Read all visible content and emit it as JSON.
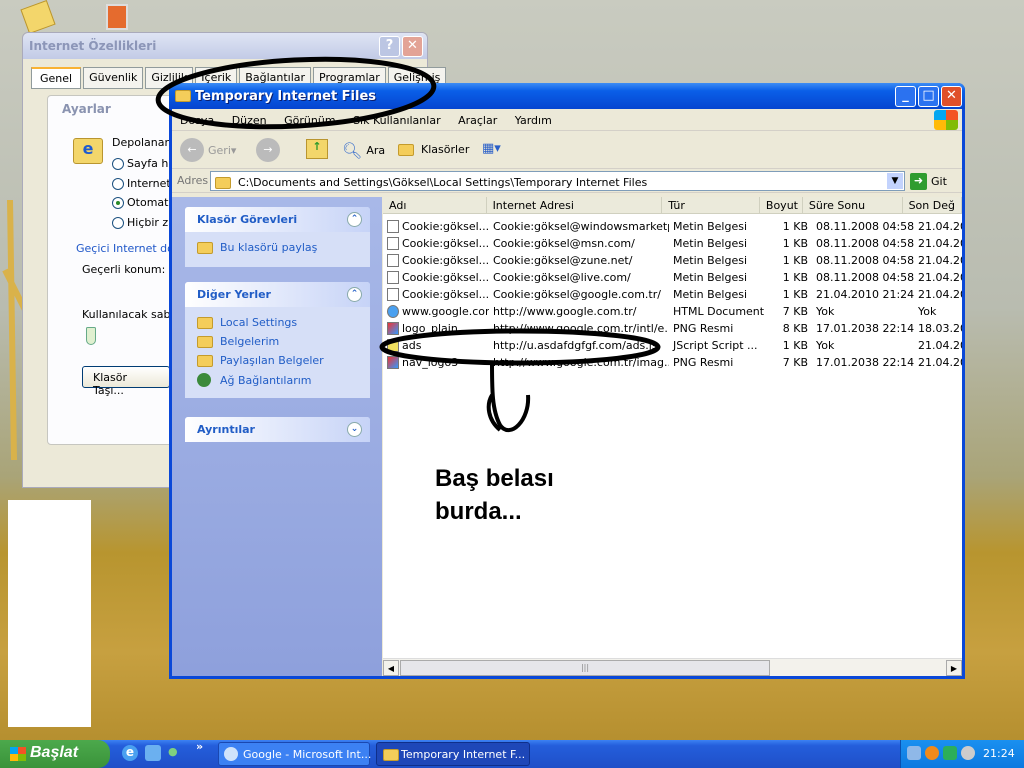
{
  "desktop": {
    "icons": [
      "folder-icon",
      "app-icon"
    ]
  },
  "internet_options": {
    "title": "Internet Özellikleri",
    "tabs": [
      "Genel",
      "Güvenlik",
      "Gizlilik",
      "İçerik",
      "Bağlantılar",
      "Programlar",
      "Gelişmiş"
    ],
    "group_title": "Ayarlar",
    "depolanan_label": "Depolanan s",
    "radios": [
      {
        "label": "Sayfa he",
        "checked": false
      },
      {
        "label": "Internet",
        "checked": false
      },
      {
        "label": "Otomatik",
        "checked": true
      },
      {
        "label": "Hiçbir zar",
        "checked": false
      }
    ],
    "link": "Geçici Internet dos",
    "current_location_label": "Geçerli konum:",
    "disk_label": "Kullanılacak sabit d",
    "move_folder_button": "Klasör Taşı..."
  },
  "explorer": {
    "title": "Temporary Internet Files",
    "menu": [
      "Dosya",
      "Düzen",
      "Görünüm",
      "Sık Kullanılanlar",
      "Araçlar",
      "Yardım"
    ],
    "toolbar": {
      "back": "Geri",
      "search": "Ara",
      "folders": "Klasörler"
    },
    "address_label": "Adres",
    "address": "C:\\Documents and Settings\\Göksel\\Local Settings\\Temporary Internet Files",
    "go": "Git",
    "tasks": {
      "title": "Klasör Görevleri",
      "items": [
        "Bu klasörü paylaş"
      ]
    },
    "other_places": {
      "title": "Diğer Yerler",
      "items": [
        "Local Settings",
        "Belgelerim",
        "Paylaşılan Belgeler",
        "Ağ Bağlantılarım"
      ]
    },
    "details": {
      "title": "Ayrıntılar"
    },
    "columns": [
      "Adı",
      "Internet Adresi",
      "Tür",
      "Boyut",
      "Süre Sonu",
      "Son Değ"
    ],
    "rows": [
      [
        "Cookie:göksel...",
        "Cookie:göksel@windowsmarketp...",
        "Metin Belgesi",
        "1 KB",
        "08.11.2008 04:58",
        "21.04.20"
      ],
      [
        "Cookie:göksel...",
        "Cookie:göksel@msn.com/",
        "Metin Belgesi",
        "1 KB",
        "08.11.2008 04:58",
        "21.04.20"
      ],
      [
        "Cookie:göksel...",
        "Cookie:göksel@zune.net/",
        "Metin Belgesi",
        "1 KB",
        "08.11.2008 04:58",
        "21.04.20"
      ],
      [
        "Cookie:göksel...",
        "Cookie:göksel@live.com/",
        "Metin Belgesi",
        "1 KB",
        "08.11.2008 04:58",
        "21.04.20"
      ],
      [
        "Cookie:göksel...",
        "Cookie:göksel@google.com.tr/",
        "Metin Belgesi",
        "1 KB",
        "21.04.2010 21:24",
        "21.04.20"
      ],
      [
        "www.google.com",
        "http://www.google.com.tr/",
        "HTML Document",
        "7 KB",
        "Yok",
        "Yok"
      ],
      [
        "logo_plain",
        "http://www.google.com.tr/intl/e...",
        "PNG Resmi",
        "8 KB",
        "17.01.2038 22:14",
        "18.03.20"
      ],
      [
        "ads",
        "http://u.asdafdgfgf.com/ads.js",
        "JScript Script ...",
        "1 KB",
        "Yok",
        "21.04.20"
      ],
      [
        "nav_logo3",
        "http://www.google.com.tr/imag...",
        "PNG Resmi",
        "7 KB",
        "17.01.2038 22:14",
        "21.04.20"
      ]
    ],
    "row_icons": [
      "text-file-icon",
      "text-file-icon",
      "text-file-icon",
      "text-file-icon",
      "text-file-icon",
      "ie-document-icon",
      "png-image-icon",
      "jscript-icon",
      "png-image-icon"
    ]
  },
  "annotation": {
    "line1": "Baş belası",
    "line2": "burda..."
  },
  "taskbar": {
    "start": "Başlat",
    "tasks": [
      "Google - Microsoft Int...",
      "Temporary Internet F..."
    ],
    "clock": "21:24"
  }
}
